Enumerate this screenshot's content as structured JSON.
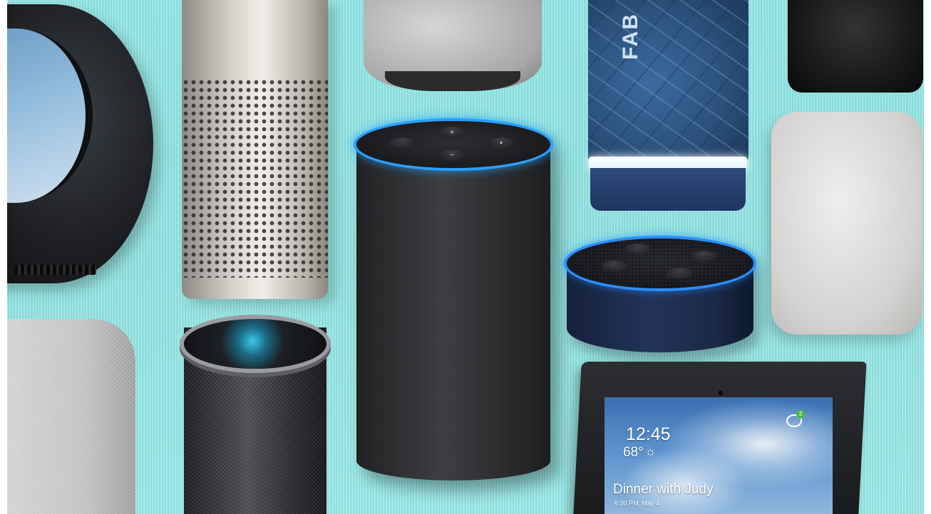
{
  "image": {
    "alt_subject": "assorted smart speakers",
    "background_color": "#8fe3e3"
  },
  "devices": {
    "fabriq": {
      "brand_text": "FAB"
    },
    "echo_show": {
      "time": "12:45",
      "temperature": "68°",
      "weather_icon": "sun-icon",
      "event_title": "Dinner with Judy",
      "event_subtitle": "6:30 PM, May 4",
      "notification_count": "3"
    },
    "echo": {
      "buttons": [
        "−",
        "+",
        "•",
        "•"
      ]
    }
  }
}
